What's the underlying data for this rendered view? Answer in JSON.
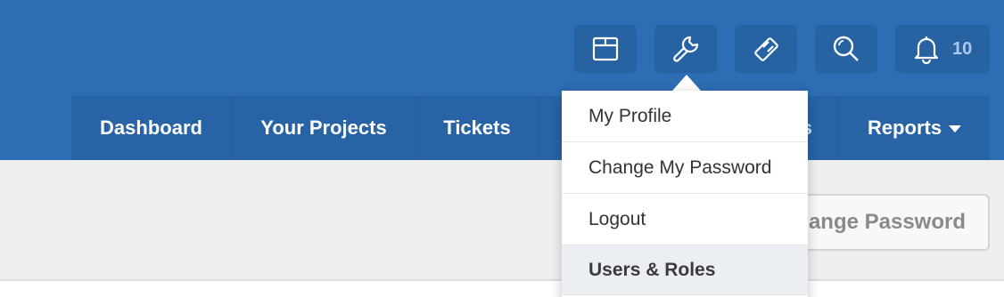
{
  "topbar": {
    "icons": [
      "box-icon",
      "wrench-icon",
      "ticket-icon",
      "search-icon",
      "bell-icon"
    ],
    "notification_count": "10"
  },
  "nav": {
    "items": [
      {
        "label": "Dashboard"
      },
      {
        "label": "Your Projects"
      },
      {
        "label": "Tickets"
      },
      {
        "label": "s"
      },
      {
        "label": "Reports"
      }
    ]
  },
  "dropdown": {
    "items": [
      {
        "label": "My Profile"
      },
      {
        "label": "Change My Password"
      },
      {
        "label": "Logout"
      },
      {
        "label": "Users & Roles"
      }
    ]
  },
  "content": {
    "change_password_button": "ange Password"
  },
  "colors": {
    "header_bg": "#2d6db3",
    "nav_bg": "#2863a5",
    "content_bg": "#efefef",
    "hover_bg": "#ebeef2"
  }
}
